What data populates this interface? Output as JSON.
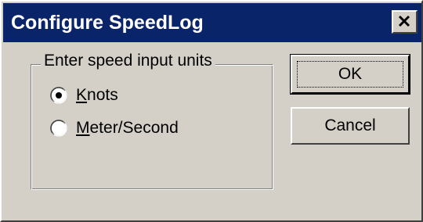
{
  "window": {
    "title": "Configure SpeedLog",
    "close_glyph": "×"
  },
  "group": {
    "label": "Enter speed input units",
    "options": [
      {
        "accel": "K",
        "rest": "nots",
        "selected": true
      },
      {
        "accel": "M",
        "rest": "eter/Second",
        "selected": false
      }
    ]
  },
  "buttons": {
    "ok": "OK",
    "cancel": "Cancel"
  },
  "icons": {
    "close": "close-icon"
  }
}
